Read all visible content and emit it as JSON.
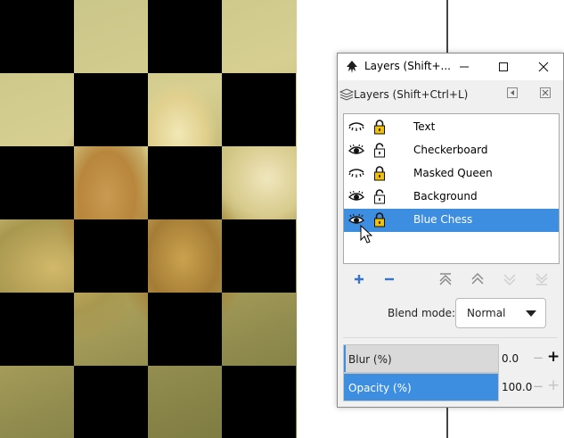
{
  "window": {
    "title": "Layers (Shift+...",
    "app_icon": "inkscape-icon",
    "minimize_icon": "minimize-icon",
    "maximize_icon": "maximize-icon",
    "close_icon": "close-icon"
  },
  "dock": {
    "title": "Layers (Shift+Ctrl+L)",
    "icon": "layers-icon",
    "collapse_icon": "dock-collapse-icon",
    "close_icon": "dock-close-icon"
  },
  "layers": [
    {
      "name": "Text",
      "visible": false,
      "locked": true,
      "selected": false
    },
    {
      "name": "Checkerboard",
      "visible": true,
      "locked": false,
      "selected": false
    },
    {
      "name": "Masked Queen",
      "visible": false,
      "locked": true,
      "selected": false
    },
    {
      "name": "Background",
      "visible": true,
      "locked": false,
      "selected": false
    },
    {
      "name": "Blue Chess",
      "visible": true,
      "locked": true,
      "selected": true
    }
  ],
  "toolbar": {
    "add_icon": "plus-icon",
    "remove_icon": "minus-icon",
    "raise_top_icon": "raise-to-top-icon",
    "raise_icon": "raise-icon",
    "lower_icon": "lower-icon",
    "lower_bottom_icon": "lower-to-bottom-icon"
  },
  "blend": {
    "label": "Blend mode:",
    "value": "Normal"
  },
  "blur": {
    "label": "Blur (%)",
    "value": "0.0",
    "level": 0
  },
  "opacity": {
    "label": "Opacity (%)",
    "value": "100.0",
    "level": 100
  },
  "colors": {
    "selection": "#3d8ee0",
    "lock": "#f2c200",
    "add": "#3b73c5",
    "remove": "#3b73c5"
  }
}
